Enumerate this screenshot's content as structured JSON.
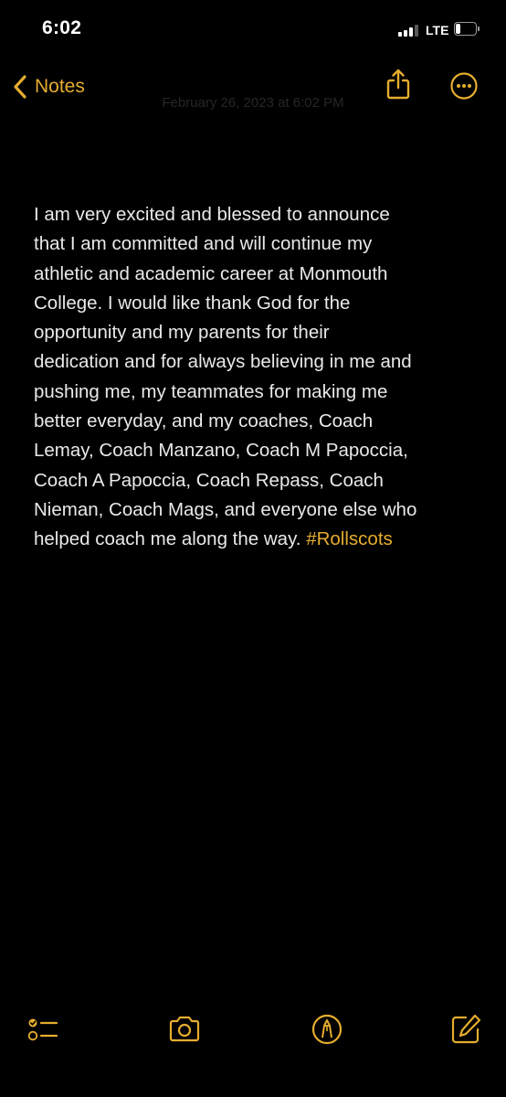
{
  "status_bar": {
    "time": "6:02",
    "network": "LTE",
    "signal_bars_active": 3,
    "signal_bars_total": 4,
    "battery_level": 0.25
  },
  "nav": {
    "back_label": "Notes",
    "date_text": "February 26, 2023 at 6:02 PM",
    "icons": [
      "chevron-left-icon",
      "share-icon",
      "more-icon"
    ]
  },
  "note": {
    "body": "I am very excited and blessed to announce\nthat I am committed and will continue my\nathletic and academic career at Monmouth\nCollege. I would like thank God for the\nopportunity and my parents for their\ndedication and for always believing in me and\npushing me, my teammates for making me\nbetter everyday, and my coaches, Coach\nLemay, Coach Manzano, Coach M Papoccia,\nCoach A Papoccia, Coach Repass, Coach\nNieman, Coach Mags, and everyone else who\nhelped coach me along the way. ",
    "hashtag": "#Rollscots"
  },
  "toolbar": {
    "icons": [
      "checklist-icon",
      "camera-icon",
      "markup-icon",
      "compose-icon"
    ]
  },
  "colors": {
    "background": "#000000",
    "accent": "#e5ad2f",
    "text": "#e9e9e9"
  }
}
